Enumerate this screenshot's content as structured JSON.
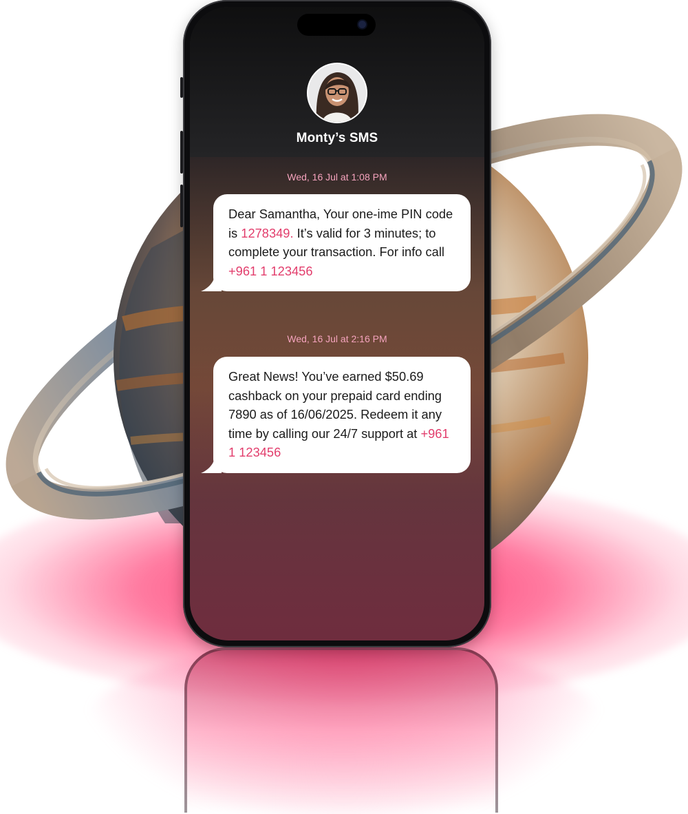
{
  "contact": {
    "name": "Monty’s SMS"
  },
  "messages": [
    {
      "timestamp": "Wed, 16 Jul at 1:08 PM",
      "parts": [
        "Dear Samantha, Your one-ime PIN code is ",
        "1278349.",
        " It’s valid for 3 minutes; to complete your transaction. For info call ",
        "+961 1 123456"
      ]
    },
    {
      "timestamp": "Wed, 16 Jul at 2:16 PM",
      "parts": [
        "Great News! You’ve earned $50.69 cashback on your prepaid card ending 7890 as of 16/06/2025. Redeem it any time by calling our 24/7 support at ",
        "+961 1 123456"
      ]
    }
  ],
  "colors": {
    "accent": "#e23d6c",
    "timestamp": "#f5a3bd",
    "glow": "#ff2a64"
  }
}
